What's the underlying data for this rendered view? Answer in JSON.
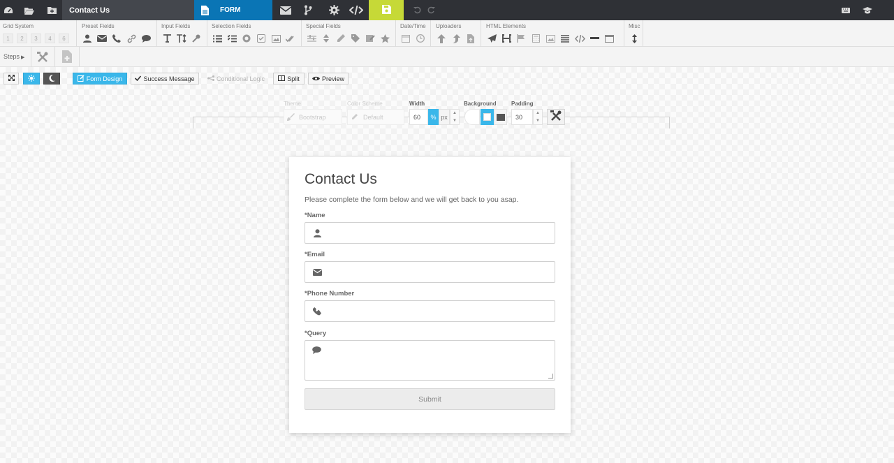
{
  "topbar": {
    "document_title": "Contact Us",
    "form_tab_label": "FORM",
    "icons": [
      "dashboard-icon",
      "folder-open-icon",
      "folder-plus-icon",
      "envelope-icon",
      "branch-icon",
      "gear-icon",
      "code-icon",
      "save-icon",
      "undo-icon",
      "redo-icon",
      "keyboard-icon",
      "graduation-cap-icon"
    ]
  },
  "toolbar": {
    "groups": [
      {
        "label": "Grid System",
        "items": [
          "1",
          "2",
          "3",
          "4",
          "6"
        ]
      },
      {
        "label": "Preset Fields"
      },
      {
        "label": "Input Fields"
      },
      {
        "label": "Selection Fields"
      },
      {
        "label": "Special Fields"
      },
      {
        "label": "Date/Time"
      },
      {
        "label": "Uploaders"
      },
      {
        "label": "HTML Elements"
      },
      {
        "label": "Misc"
      }
    ]
  },
  "steps": {
    "label": "Steps"
  },
  "view": {
    "form_design": "Form Design",
    "success_message": "Success Message",
    "conditional_logic": "Conditional Logic",
    "split": "Split",
    "preview": "Preview"
  },
  "settings": {
    "theme_label": "Theme",
    "theme_value": "Bootstrap",
    "color_scheme_label": "Color Scheme",
    "color_scheme_value": "Default",
    "width_label": "Width",
    "width_value": "60",
    "width_unit_percent": "%",
    "width_unit_px": "px",
    "background_label": "Background",
    "padding_label": "Padding",
    "padding_value": "30"
  },
  "form": {
    "title": "Contact Us",
    "subtitle": "Please complete the form below and we will get back to you asap.",
    "fields": [
      {
        "label": "*Name",
        "icon": "user-icon"
      },
      {
        "label": "*Email",
        "icon": "envelope-icon"
      },
      {
        "label": "*Phone Number",
        "icon": "phone-icon"
      },
      {
        "label": "*Query",
        "icon": "comment-icon"
      }
    ],
    "submit_label": "Submit"
  },
  "colors": {
    "topbar": "#2f3136",
    "form_tab": "#0a75b5",
    "save": "#c6d937",
    "accent": "#3ab7ea"
  }
}
